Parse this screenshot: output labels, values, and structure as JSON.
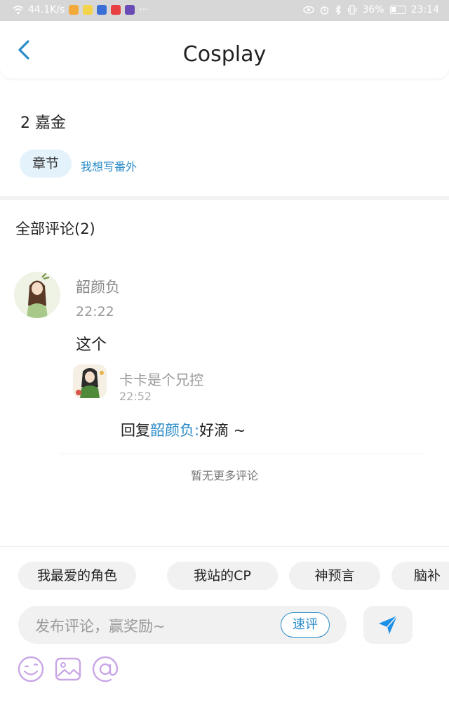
{
  "status_bar": {
    "speed": "44.1K/s",
    "more": "···",
    "battery_percent": "36%",
    "time": "23:14"
  },
  "header": {
    "title": "Cosplay"
  },
  "chapter": {
    "title": "2 嘉金",
    "tag_label": "章节",
    "write_link": "我想写番外"
  },
  "comments": {
    "heading": "全部评论(2)",
    "items": [
      {
        "user": "韶颜负",
        "time": "22:22",
        "text": "这个",
        "replies": [
          {
            "user": "卡卡是个兄控",
            "time": "22:52",
            "reply_prefix": "回复",
            "reply_to": "韶颜负",
            "reply_colon": ":",
            "reply_text": "好滴 ~"
          }
        ]
      }
    ],
    "no_more": "暂无更多评论"
  },
  "composer": {
    "chips": [
      "我最爱的角色",
      "我站的CP",
      "神预言",
      "脑补"
    ],
    "placeholder": "发布评论，赢奖励~",
    "quick_label": "速评"
  },
  "colors": {
    "accent": "#2a8bc8",
    "tag_bg": "#e4f2fb",
    "chip_bg": "#f1f1f1",
    "icon_purple": "#c9a6e6"
  }
}
